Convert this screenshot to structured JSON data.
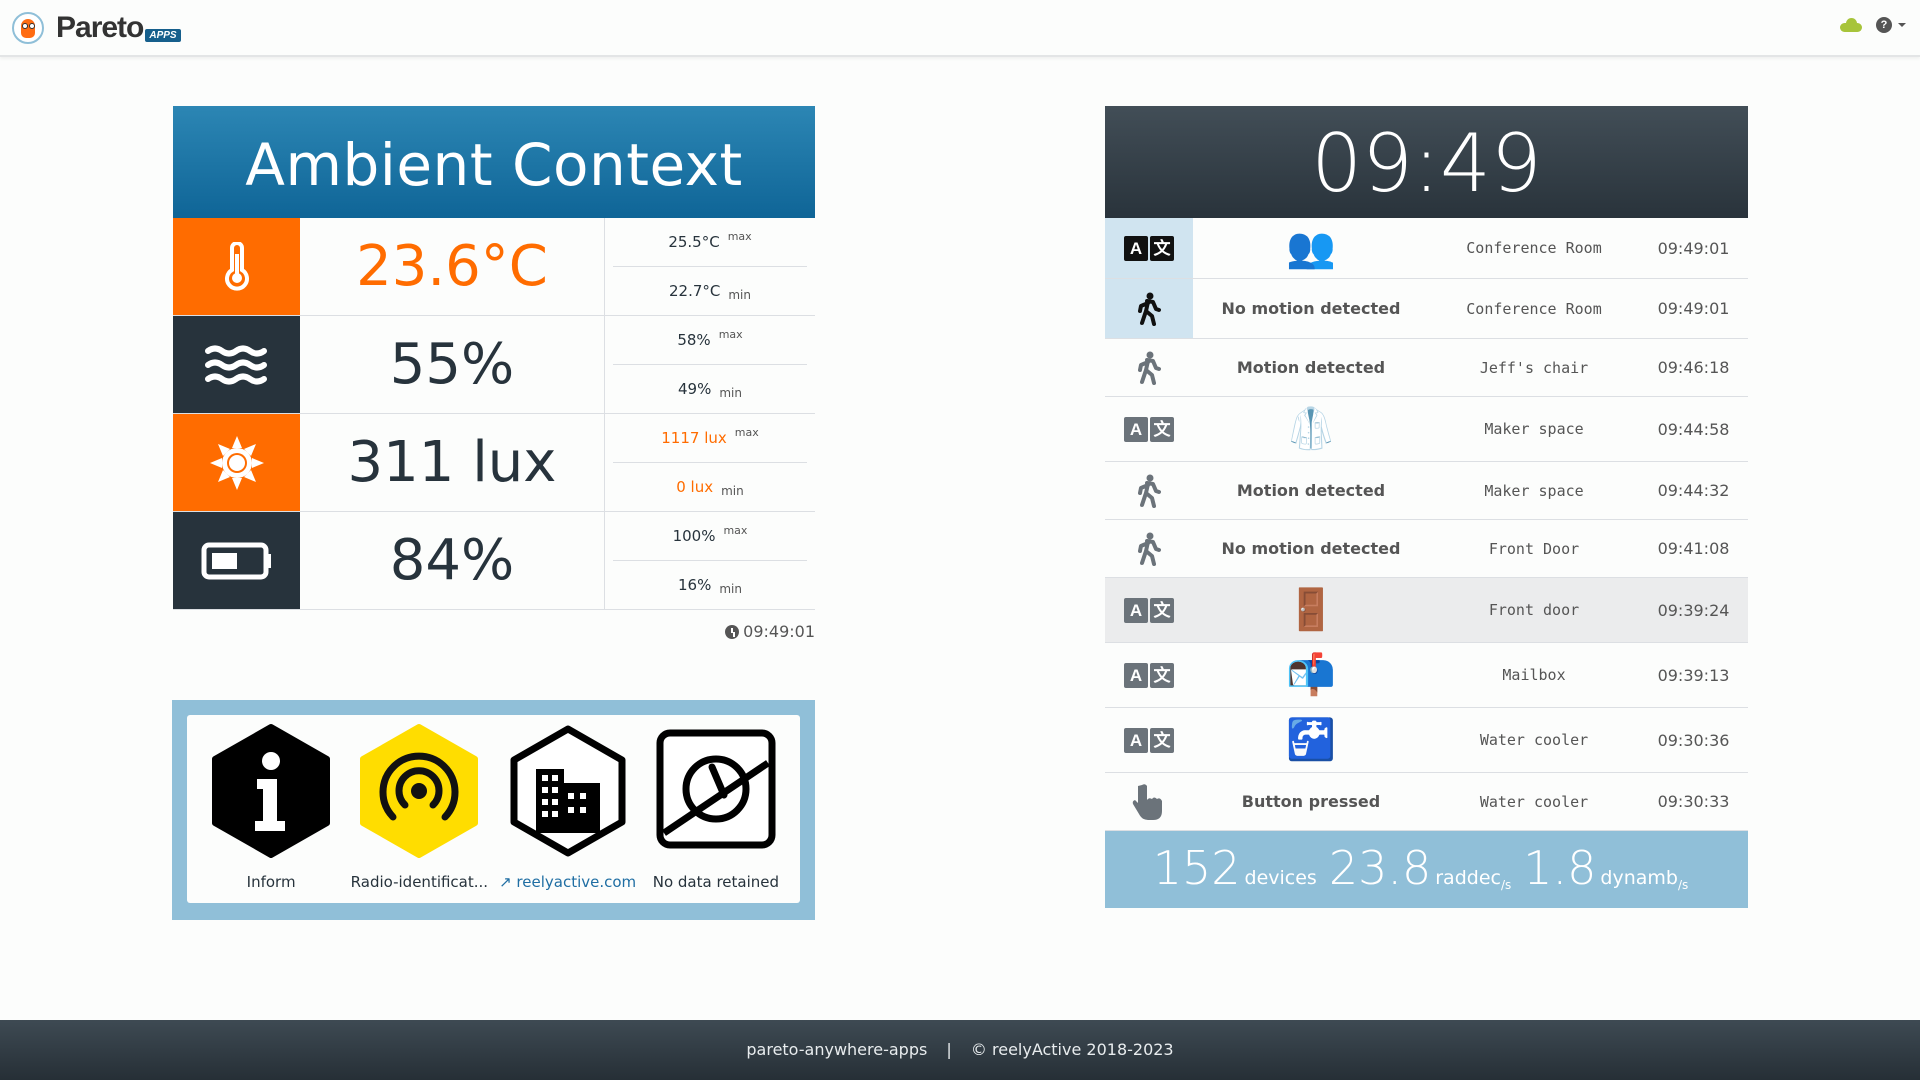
{
  "navbar": {
    "brand_name": "Pareto",
    "brand_tag": "APPS",
    "status_icon": "cloud-connected-icon",
    "help_icon": "question-circle-icon"
  },
  "ambient": {
    "title": "Ambient Context",
    "rows": [
      {
        "icon": "thermometer-icon",
        "value": "23.6°C",
        "max": "25.5°C",
        "min": "22.7°C",
        "max_label": "max",
        "min_label": "min"
      },
      {
        "icon": "humidity-waves-icon",
        "value": "55%",
        "max": "58%",
        "min": "49%",
        "max_label": "max",
        "min_label": "min"
      },
      {
        "icon": "sun-icon",
        "value": "311 lux",
        "max": "1117 lux",
        "min": "0 lux",
        "max_label": "max",
        "min_label": "min"
      },
      {
        "icon": "battery-icon",
        "value": "84%",
        "max": "100%",
        "min": "16%",
        "max_label": "max",
        "min_label": "min"
      }
    ],
    "timestamp": "09:49:01"
  },
  "badges": [
    {
      "icon": "info-hexagon-icon",
      "label": "Inform"
    },
    {
      "icon": "radio-identification-hexagon-icon",
      "label": "Radio-identificat..."
    },
    {
      "icon": "building-hexagon-icon",
      "label": "reelyactive.com"
    },
    {
      "icon": "no-data-retained-icon",
      "label": "No data retained"
    }
  ],
  "events": {
    "clock": "09:49",
    "rows": [
      {
        "icon": "translate-icon",
        "what_emoji": "👥",
        "what": "",
        "where": "Conference Room",
        "when": "09:49:01",
        "recent": true
      },
      {
        "icon": "walking-person-icon",
        "what_emoji": "",
        "what": "No motion detected",
        "where": "Conference Room",
        "when": "09:49:01",
        "recent": true
      },
      {
        "icon": "walking-person-icon",
        "what_emoji": "",
        "what": "Motion detected",
        "where": "Jeff's chair",
        "when": "09:46:18"
      },
      {
        "icon": "translate-icon",
        "what_emoji": "🥼",
        "what": "",
        "where": "Maker space",
        "when": "09:44:58"
      },
      {
        "icon": "walking-person-icon",
        "what_emoji": "",
        "what": "Motion detected",
        "where": "Maker space",
        "when": "09:44:32"
      },
      {
        "icon": "walking-person-icon",
        "what_emoji": "",
        "what": "No motion detected",
        "where": "Front Door",
        "when": "09:41:08"
      },
      {
        "icon": "translate-icon",
        "what_emoji": "🚪",
        "what": "",
        "where": "Front door",
        "when": "09:39:24",
        "highlight": true
      },
      {
        "icon": "translate-icon",
        "what_emoji": "📬",
        "what": "",
        "where": "Mailbox",
        "when": "09:39:13"
      },
      {
        "icon": "translate-icon",
        "what_emoji": "🚰",
        "what": "",
        "where": "Water cooler",
        "when": "09:30:36"
      },
      {
        "icon": "pointing-hand-icon",
        "what_emoji": "",
        "what": "Button pressed",
        "where": "Water cooler",
        "when": "09:30:33"
      }
    ],
    "stats": {
      "devices": "152",
      "devices_label": "devices",
      "raddec": "23.8",
      "raddec_label": "raddec",
      "raddec_sub": "/s",
      "dynamb": "1.8",
      "dynamb_label": "dynamb",
      "dynamb_sub": "/s"
    }
  },
  "footer": {
    "left": "pareto-anywhere-apps",
    "separator": "|",
    "right": "© reelyActive 2018-2023"
  },
  "colors": {
    "accent_orange": "#ff6c00",
    "dark": "#27333c",
    "blue_header": "#1a74a5",
    "light_blue": "#90bfd8",
    "status_green": "#a7c43a"
  }
}
